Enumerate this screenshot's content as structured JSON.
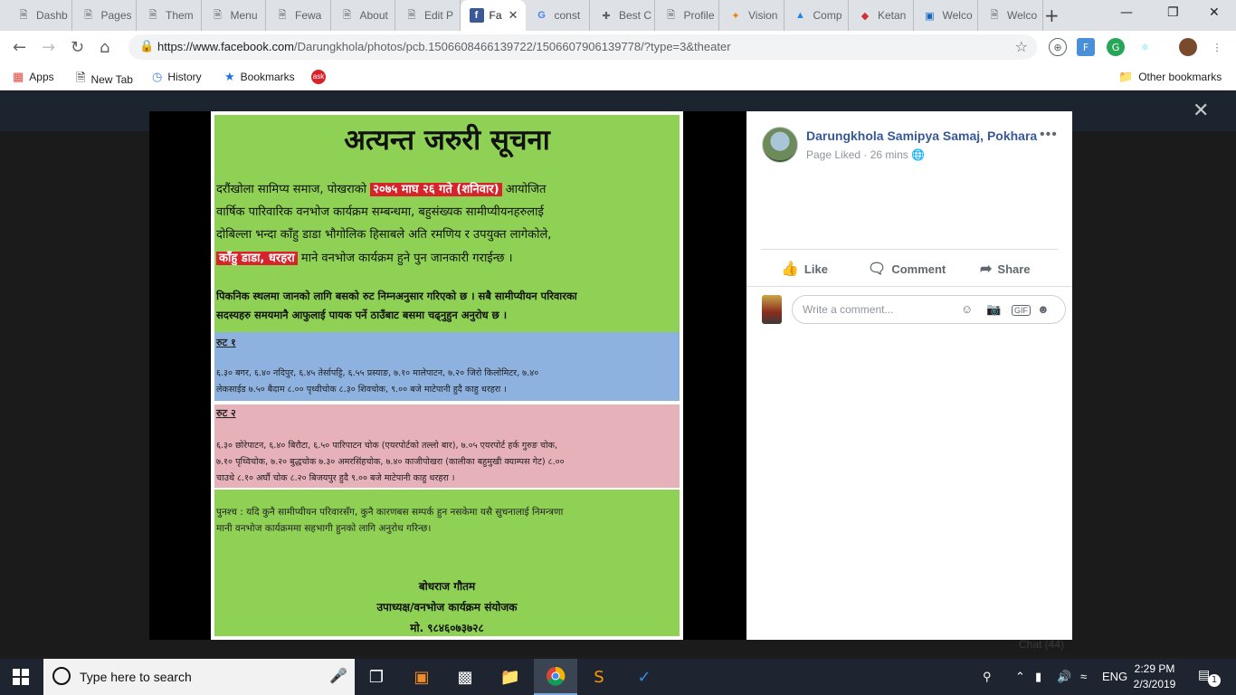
{
  "browser": {
    "tabs": [
      {
        "label": "Dashb",
        "icon": "doc-icon"
      },
      {
        "label": "Pages",
        "icon": "doc-icon"
      },
      {
        "label": "Them",
        "icon": "doc-icon"
      },
      {
        "label": "Menu",
        "icon": "doc-icon"
      },
      {
        "label": "Fewa",
        "icon": "doc-icon"
      },
      {
        "label": "About",
        "icon": "doc-icon"
      },
      {
        "label": "Edit P",
        "icon": "doc-icon"
      },
      {
        "label": "Fa",
        "icon": "facebook-icon",
        "active": true
      },
      {
        "label": "const",
        "icon": "google-icon"
      },
      {
        "label": "Best C",
        "icon": "tool-icon"
      },
      {
        "label": "Profile",
        "icon": "doc-icon"
      },
      {
        "label": "Vision",
        "icon": "spark-icon"
      },
      {
        "label": "Comp",
        "icon": "triangle-icon"
      },
      {
        "label": "Ketan",
        "icon": "diamond-icon"
      },
      {
        "label": "Welco",
        "icon": "hcc-icon"
      },
      {
        "label": "Welco",
        "icon": "doc-icon"
      }
    ],
    "url_domain": "https://www.facebook.com",
    "url_path": "/Darungkhola/photos/pcb.1506608466139722/1506607906139778/?type=3&theater",
    "bookmarks": [
      {
        "label": "Apps",
        "icon": "apps-grid-icon"
      },
      {
        "label": "New Tab",
        "icon": "doc-icon"
      },
      {
        "label": "History",
        "icon": "history-icon"
      },
      {
        "label": "Bookmarks",
        "icon": "star-icon"
      },
      {
        "label": "",
        "icon": "ask-icon"
      }
    ],
    "other_bookmarks": "Other bookmarks"
  },
  "poster": {
    "title": "अत्यन्त जरुरी सूचना",
    "para1_line1_pre": "दरौंखोला सामिप्य समाज, पोखराको ",
    "para1_date": "२०७५ माघ २६ गते (शनिवार)",
    "para1_line1_post": " आयोजित",
    "para1_line2": "वार्षिक पारिवारिक वनभोज कार्यक्रम सम्बन्धमा, बहुसंख्यक सामीप्यीयनहरुलाई",
    "para1_line3": "दोबिल्ला भन्दा काँहु डाडा भौगोलिक हिसाबले अति रमणिय र उपयुक्त लागेकोले,",
    "para1_place": "काँहु डाडा, धरहरा",
    "para1_line4_post": "  माने वनभोज कार्यक्रम हुने पुन जानकारी गराईन्छ ।",
    "para2_line1": "पिकनिक स्थलमा जानको लागि बसको रुट निम्नअनुसार गरिएको छ । सबै सामीप्यीयन परिवारका",
    "para2_line2": "सदस्यहरु समयमानै आफुलाई पायक पर्ने ठाउँबाट बसमा चढ्नुहुन अनुरोध छ ।",
    "route1_label": "रुट  १",
    "route1_line1": "६.३० बगर, ६.४० नदिपुर, ६.४५ तेर्सापट्टि, ६.५५ प्रस्याङ, ७.१० मालेपाटन, ७.२० जिरो किलोमिटर, ७.४०",
    "route1_line2": "लेकसाईड ७.५० बैदाम ८.०० पृथ्वीचोक ८.३० शिवचोक, ९.०० बजे माटेपानी हुदै काहु धरहरा ।",
    "route2_label": "रुट  २",
    "route2_line1": "६.३० छोरेपाटन, ६.४० बिरौटा, ६.५० पारिपाटन चोक (एयरपोर्टको तल्लो बार), ७.०५ एयरपोर्ट हर्क गुरुङ चोक,",
    "route2_line2": "७.१० पृथ्विचोक, ७.२० बुद्धचोक  ७.३० अमरसिंहचोक, ७.४० काजीपोखरा (कालीका बहुमुखी क्याम्पस गेट) ८.००",
    "route2_line3": "चाउथे  ८.१० अर्घौ चोक ८.२० बिजयपुर हुदै ९.०० बजे माटेपानी काहु धरहरा ।",
    "ps_line1": "पुनश्च : यदि कुनै सामीप्यीयन परिवारसँग, कुनै कारणबस सम्पर्क हुन नसकेमा यसै सुचनालाई निमन्त्रणा",
    "ps_line2": "मानी वनभोज कार्यक्रममा सहभागी हुनको लागि अनुरोध गरिन्छ।",
    "sign_name": "बोधराज गौतम",
    "sign_title": "उपाध्यक्ष/वनभोज कार्यक्रम संयोजक",
    "sign_phone": "मो. ९८४६०७३७२८",
    "colors": {
      "green": "#8fd154",
      "blue": "#8eb2e0",
      "pink": "#e6b1b8",
      "highlight": "#d8232a"
    }
  },
  "panel": {
    "page_name": "Darungkhola Samipya Samaj, Pokhara",
    "more": "•••",
    "meta_liked": "Page Liked",
    "meta_sep": "·",
    "meta_time": "26 mins",
    "like": "Like",
    "comment": "Comment",
    "share": "Share",
    "comment_placeholder": "Write a comment..."
  },
  "background": {
    "chat": "Chat (44)"
  },
  "taskbar": {
    "search_placeholder": "Type here to search",
    "lang": "ENG",
    "time": "2:29 PM",
    "date": "2/3/2019",
    "notif_count": "1"
  }
}
